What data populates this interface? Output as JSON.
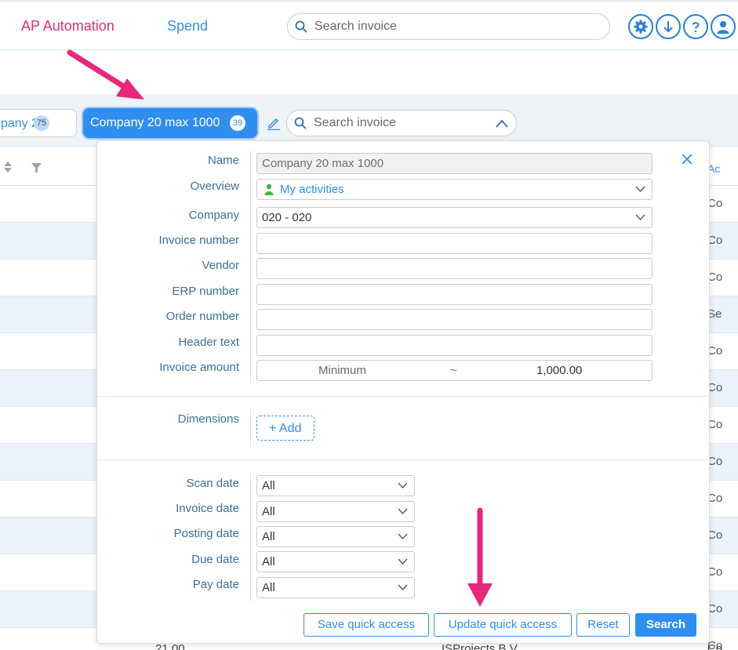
{
  "nav": {
    "ap_automation": "AP Automation",
    "spend": "Spend",
    "search_placeholder": "Search invoice"
  },
  "tabs": [
    {
      "label": "pany 20",
      "count": "75"
    },
    {
      "label": "Company 20 max 1000",
      "count": "39"
    }
  ],
  "tab_search_placeholder": "Search invoice",
  "table": {
    "right_header": "Ac",
    "right_cells": [
      "Co",
      "Co",
      "Co",
      "Se",
      "Co",
      "Co",
      "Co",
      "Co",
      "Co",
      "Co",
      "Co",
      "Co",
      "Co"
    ],
    "bottom_values": [
      "21.00",
      "ISProjects B.V.",
      "Co"
    ]
  },
  "filter": {
    "labels": {
      "name": "Name",
      "overview": "Overview",
      "company": "Company",
      "invoice_number": "Invoice number",
      "vendor": "Vendor",
      "erp_number": "ERP number",
      "order_number": "Order number",
      "header_text": "Header text",
      "invoice_amount": "Invoice amount",
      "dimensions": "Dimensions",
      "scan_date": "Scan date",
      "invoice_date": "Invoice date",
      "posting_date": "Posting date",
      "due_date": "Due date",
      "pay_date": "Pay date"
    },
    "values": {
      "name": "Company 20 max 1000",
      "overview": "My activities",
      "company": "020 - 020",
      "invoice_number": "",
      "vendor": "",
      "erp_number": "",
      "order_number": "",
      "header_text": "",
      "amount_min": "Minimum",
      "amount_separator": "~",
      "amount_max": "1,000.00",
      "scan_date": "All",
      "invoice_date": "All",
      "posting_date": "All",
      "due_date": "All",
      "pay_date": "All"
    },
    "add_label": "+ Add",
    "buttons": {
      "save_quick_access": "Save quick access",
      "update_quick_access": "Update quick access",
      "reset": "Reset",
      "search": "Search"
    }
  },
  "colors": {
    "accent": "#2f8ef0",
    "brand_pink": "#e2306c",
    "label_blue": "#3d6e9a"
  }
}
